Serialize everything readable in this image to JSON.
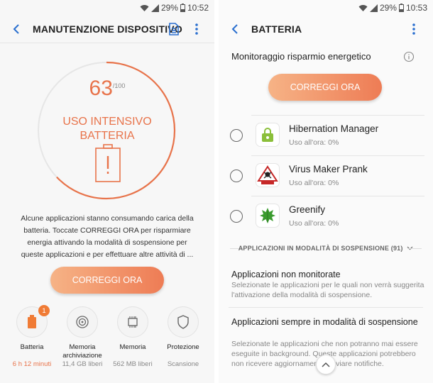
{
  "left": {
    "status": {
      "battery": "29%",
      "time": "10:52"
    },
    "title": "MANUTENZIONE DISPOSITIVO",
    "score": {
      "value": "63",
      "max": "/100"
    },
    "usage_line1": "USO INTENSIVO",
    "usage_line2": "BATTERIA",
    "description": "Alcune applicazioni stanno consumando carica della batteria. Toccate CORREGGI ORA per risparmiare energia attivando la modalità di sospensione per queste applicazioni e per effettuare altre attività di ...",
    "fix_button": "CORREGGI ORA",
    "tools": [
      {
        "label": "Batteria",
        "value": "6 h 12 minuti",
        "badge": "1",
        "icon": "battery-icon"
      },
      {
        "label": "Memoria archiviazione",
        "value": "11,4 GB liberi",
        "icon": "storage-icon"
      },
      {
        "label": "Memoria",
        "value": "562 MB liberi",
        "icon": "memory-chip-icon"
      },
      {
        "label": "Protezione",
        "value": "Scansione",
        "icon": "shield-icon"
      }
    ],
    "accent": "#e8734a"
  },
  "right": {
    "status": {
      "battery": "29%",
      "time": "10:53"
    },
    "title": "BATTERIA",
    "monitor_label": "Monitoraggio risparmio energetico",
    "fix_button": "CORREGGI ORA",
    "apps": [
      {
        "name": "Hibernation Manager",
        "usage": "Uso all'ora: 0%",
        "icon": "hibernation-manager-icon"
      },
      {
        "name": "Virus Maker Prank",
        "usage": "Uso all'ora: 0%",
        "icon": "virus-maker-icon"
      },
      {
        "name": "Greenify",
        "usage": "Uso all'ora: 0%",
        "icon": "greenify-icon"
      }
    ],
    "sleeping_header": "APPLICAZIONI IN MODALITÀ DI SOSPENSIONE (91)",
    "unmonitored_title": "Applicazioni non monitorate",
    "unmonitored_desc": "Selezionate le applicazioni per le quali non verrà suggerita l'attivazione della modalità di sospensione.",
    "always_sleep_title": "Applicazioni sempre in modalità di sospensione",
    "always_sleep_desc": "Selezionate le applicazioni che non potranno mai essere eseguite in background. Queste applicazioni potrebbero non ricevere aggiornamenti o inviare notifiche."
  }
}
